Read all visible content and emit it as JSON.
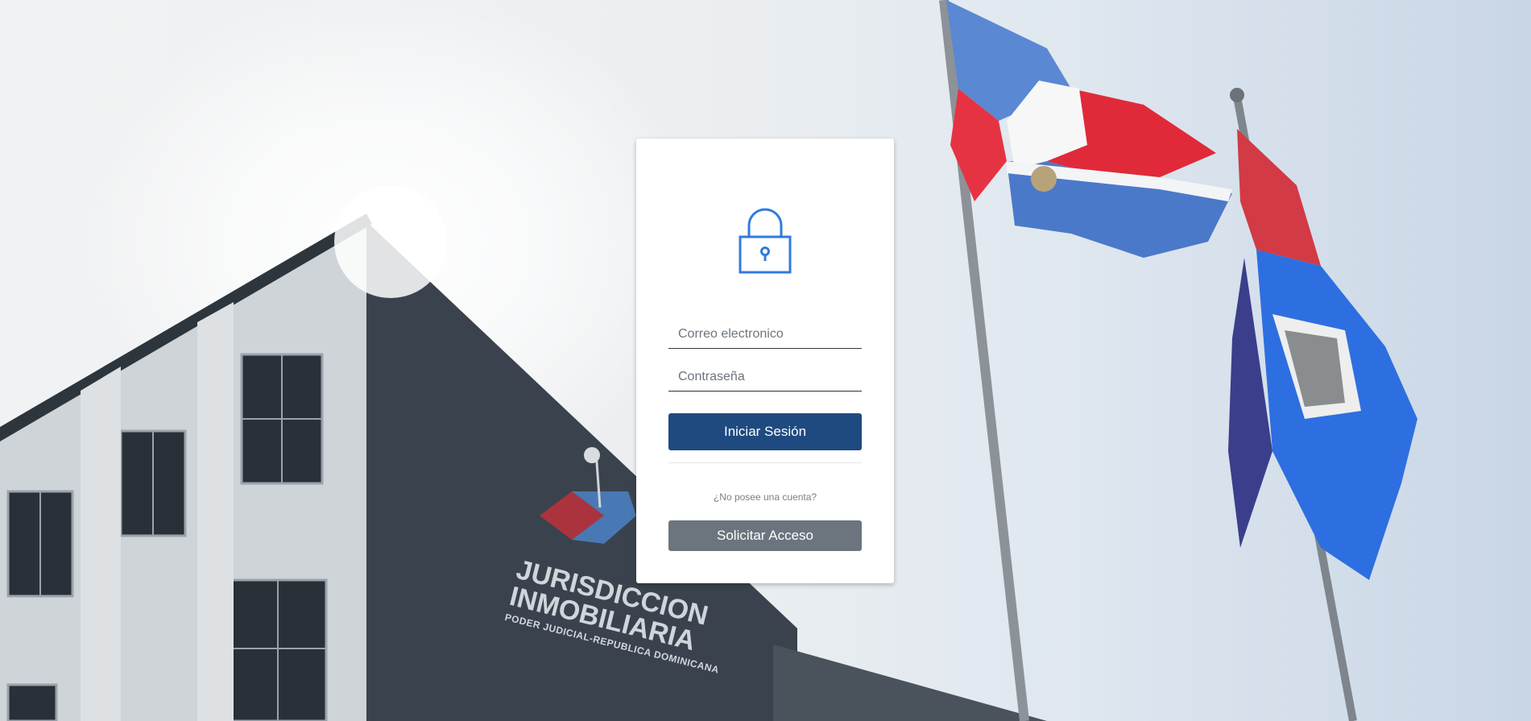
{
  "background": {
    "sign": {
      "line1": "JURISDICCION",
      "line2": "INMOBILIARIA",
      "line3": "PODER JUDICIAL-REPUBLICA DOMINICANA"
    }
  },
  "login": {
    "icon": "lock-icon",
    "email_placeholder": "Correo electronico",
    "password_placeholder": "Contraseña",
    "login_label": "Iniciar Sesión",
    "no_account_text": "¿No posee una cuenta?",
    "request_label": "Solicitar Acceso"
  },
  "colors": {
    "primary": "#1f4a80",
    "secondary": "#6c757d",
    "icon": "#2f7be0"
  }
}
